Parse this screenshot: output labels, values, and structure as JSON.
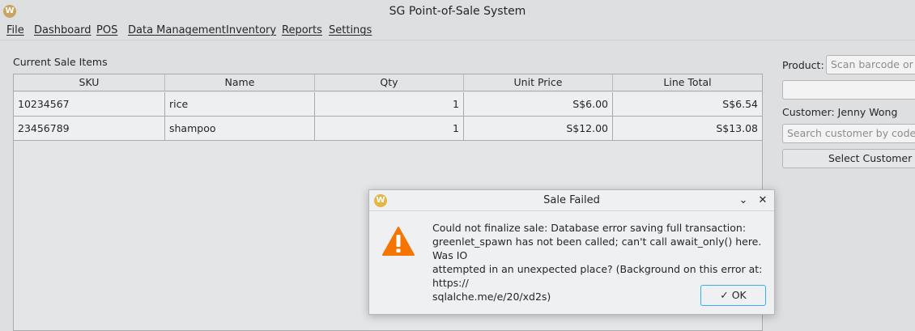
{
  "window": {
    "title": "SG Point-of-Sale System",
    "logo": "W"
  },
  "menu": [
    "File",
    "Dashboard",
    "POS",
    "Data Management",
    "Inventory",
    "Reports",
    "Settings"
  ],
  "sale": {
    "section_label": "Current Sale Items",
    "columns": [
      "SKU",
      "Name",
      "Qty",
      "Unit Price",
      "Line Total"
    ],
    "rows": [
      {
        "sku": "10234567",
        "name": "rice",
        "qty": "1",
        "unit_price": "S$6.00",
        "line_total": "S$6.54"
      },
      {
        "sku": "23456789",
        "name": "shampoo",
        "qty": "1",
        "unit_price": "S$12.00",
        "line_total": "S$13.08"
      }
    ]
  },
  "panel": {
    "product_label": "Product:",
    "product_placeholder": "Scan barcode or en",
    "customer_label": "Customer: Jenny Wong",
    "customer_search_placeholder": "Search customer by code/na",
    "select_customer_label": "Select Customer"
  },
  "dialog": {
    "title": "Sale Failed",
    "logo": "W",
    "minimize_glyph": "⌄",
    "close_glyph": "✕",
    "icon": "warning-icon",
    "message_lines": [
      "Could not finalize sale: Database error saving full transaction:",
      "greenlet_spawn has not been called; can't call await_only() here. Was IO",
      "attempted in an unexpected place? (Background on this error at: https://",
      "sqlalche.me/e/20/xd2s)"
    ],
    "ok_check": "✓",
    "ok_label": "OK"
  },
  "colors": {
    "accent": "#3daee9",
    "warning": "#f67400",
    "background": "#dedfe0"
  }
}
